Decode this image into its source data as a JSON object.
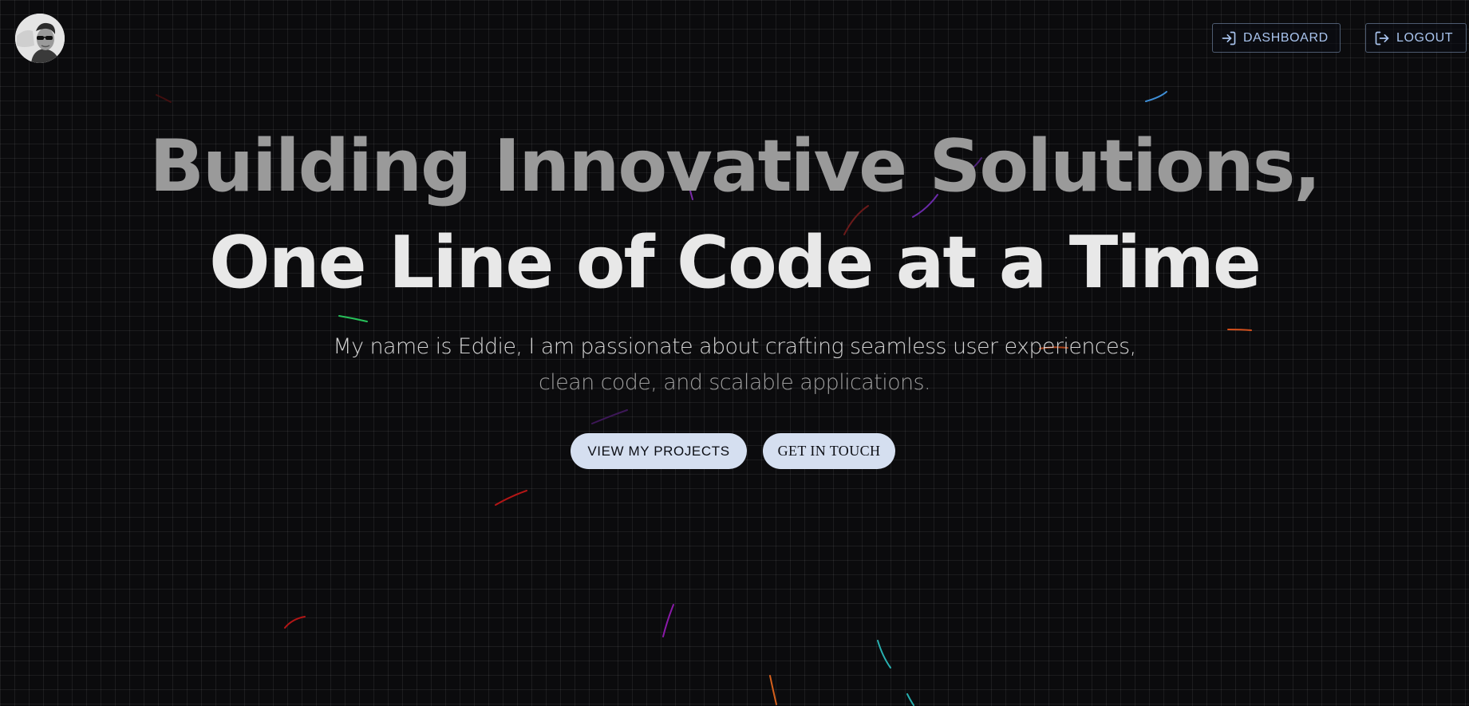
{
  "header": {
    "avatar_alt": "Eddie",
    "dashboard_label": "DASHBOARD",
    "dashboard_icon": "login-icon",
    "logout_label": "LOGOUT",
    "logout_icon": "logout-icon"
  },
  "hero": {
    "title_line1": "Building Innovative Solutions,",
    "title_line2": "One Line of Code at a Time",
    "subtitle_line1": "My name is Eddie, I am passionate about crafting seamless user experiences,",
    "subtitle_line2": "clean code, and scalable applications.",
    "primary_cta": "VIEW MY PROJECTS",
    "secondary_cta": "GET IN TOUCH"
  },
  "colors": {
    "background": "#0b0b0d",
    "accent": "#a9c4ee",
    "button_fill": "#d5dff0"
  }
}
